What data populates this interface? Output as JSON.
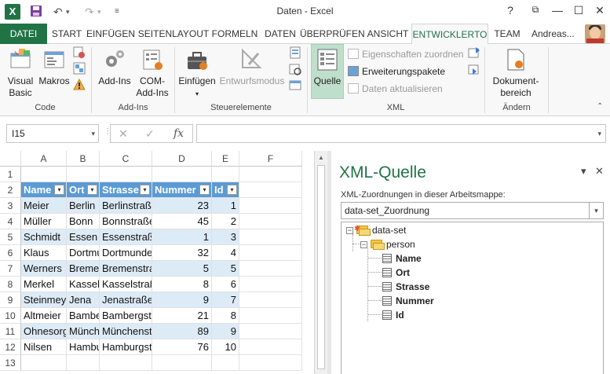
{
  "window": {
    "title": "Daten - Excel",
    "app_logo": "X",
    "controls": [
      "?",
      "⧉",
      "—",
      "☐",
      "✕"
    ]
  },
  "qat": {
    "save_icon": "save-icon",
    "undo_icon": "undo-icon",
    "redo_icon": "redo-icon",
    "customize_icon": "customize-icon"
  },
  "tabs": [
    "DATEI",
    "START",
    "EINFÜGEN",
    "SEITENLAYOUT",
    "FORMELN",
    "DATEN",
    "ÜBERPRÜFEN",
    "ANSICHT",
    "ENTWICKLERTO",
    "TEAM"
  ],
  "active_tab": "ENTWICKLERTO",
  "user": {
    "name": "Andreas..."
  },
  "ribbon": {
    "code": {
      "label": "Code",
      "visual_basic": "Visual Basic",
      "visual_basic_l1": "Visual",
      "visual_basic_l2": "Basic",
      "makros": "Makros"
    },
    "addins": {
      "label": "Add-Ins",
      "addins": "Add-Ins",
      "com_l1": "COM-",
      "com_l2": "Add-Ins"
    },
    "controls": {
      "label": "Steuerelemente",
      "einfuegen": "Einfügen",
      "entwurfsmodus": "Entwurfsmodus"
    },
    "xml": {
      "label": "XML",
      "quelle": "Quelle",
      "eigenschaften": "Eigenschaften zuordnen",
      "erweiterungspakete": "Erweiterungspakete",
      "daten_aktualisieren": "Daten aktualisieren"
    },
    "aendern": {
      "label": "Ändern",
      "doc_l1": "Dokument-",
      "doc_l2": "bereich"
    }
  },
  "formula_bar": {
    "name_box": "I15",
    "cancel": "✕",
    "enter": "✓",
    "fx": "fx",
    "value": ""
  },
  "sheet": {
    "columns": [
      "A",
      "B",
      "C",
      "D",
      "E",
      "F"
    ],
    "rows": [
      "1",
      "2",
      "3",
      "4",
      "5",
      "6",
      "7",
      "8",
      "9",
      "10",
      "11",
      "12",
      "13"
    ],
    "table_headers": [
      "Name",
      "Ort",
      "Strasse",
      "Nummer",
      "Id"
    ],
    "table_rows": [
      [
        "Meier",
        "Berlin",
        "Berlinstraße",
        "23",
        "1"
      ],
      [
        "Müller",
        "Bonn",
        "Bonnstraße",
        "45",
        "2"
      ],
      [
        "Schmidt",
        "Essen",
        "Essenstraße",
        "1",
        "3"
      ],
      [
        "Klaus",
        "Dortmund",
        "Dortmunder",
        "32",
        "4"
      ],
      [
        "Werners",
        "Bremen",
        "Bremenstraße",
        "5",
        "5"
      ],
      [
        "Merkel",
        "Kassel",
        "Kasselstraße",
        "8",
        "6"
      ],
      [
        "Steinmeyer",
        "Jena",
        "Jenastraße",
        "9",
        "7"
      ],
      [
        "Altmeier",
        "Bamberg",
        "Bambergstraße",
        "21",
        "8"
      ],
      [
        "Ohnesorg",
        "München",
        "Münchenstraße",
        "89",
        "9"
      ],
      [
        "Nilsen",
        "Hamburg",
        "Hamburgstraße",
        "76",
        "10"
      ]
    ]
  },
  "xml_pane": {
    "title": "XML-Quelle",
    "menu": "▾",
    "close": "✕",
    "subtitle": "XML-Zuordnungen in dieser Arbeitsmappe:",
    "selected_map": "data-set_Zuordnung",
    "tree": {
      "root": "data-set",
      "child": "person",
      "elements": [
        "Name",
        "Ort",
        "Strasse",
        "Nummer",
        "Id"
      ]
    }
  }
}
